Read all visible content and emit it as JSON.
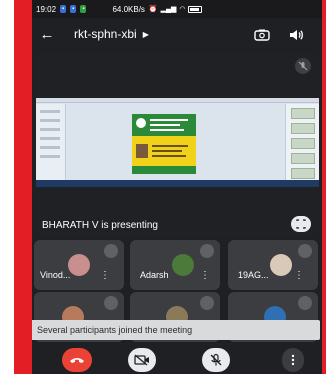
{
  "status_bar": {
    "time": "19:02",
    "network_speed": "64.0KB/s"
  },
  "meeting": {
    "code": "rkt-sphn-xbi"
  },
  "presentation": {
    "presenter_text": "BHARATH V is presenting"
  },
  "participants": [
    {
      "name": "Vinod...",
      "avatar_color": "#c98f8f"
    },
    {
      "name": "Adarsh",
      "avatar_color": "#4b7a3a"
    },
    {
      "name": "19AG...",
      "avatar_color": "#d9c9b8"
    },
    {
      "name": "",
      "avatar_color": "#b87a5c"
    },
    {
      "name": "",
      "avatar_color": "#8a7a5a"
    },
    {
      "name": "",
      "avatar_color": "#2f6fb3"
    }
  ],
  "toast": {
    "message": "Several participants joined the meeting"
  },
  "controls": {
    "end_color": "#ea4335"
  },
  "icons": [
    "back-arrow-icon",
    "chevron-right-icon",
    "switch-camera-icon",
    "speaker-icon",
    "mic-off-icon",
    "fullscreen-icon",
    "more-vert-icon",
    "end-call-icon",
    "camera-off-icon"
  ]
}
